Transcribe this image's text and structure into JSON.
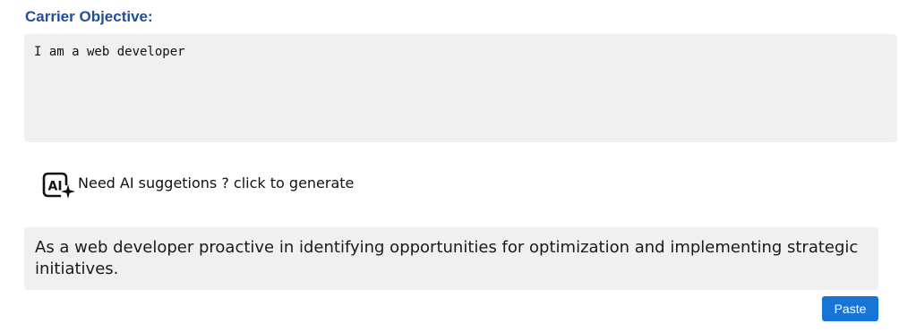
{
  "objective": {
    "label": "Carrier Objective:",
    "value": "I am a web developer"
  },
  "ai_suggestion": {
    "icon": "ai-sparkle-icon",
    "text": "Need AI suggetions ? click to generate"
  },
  "suggestion": {
    "text": "As a web developer proactive in identifying opportunities for optimization and implementing strategic initiatives."
  },
  "actions": {
    "paste_label": "Paste"
  },
  "colors": {
    "label": "#1f4e9c",
    "field_bg": "#f0f0f0",
    "button_bg": "#1773d6"
  }
}
